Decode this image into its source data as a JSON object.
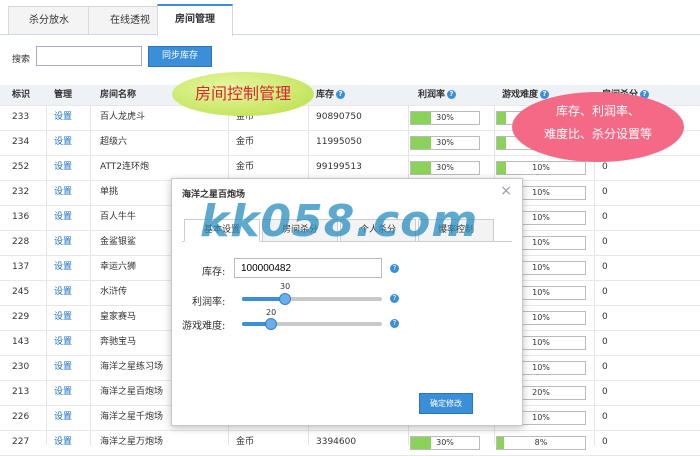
{
  "tabs": [
    "杀分放水",
    "在线透视",
    "房间管理"
  ],
  "active_tab_index": 2,
  "search": {
    "label": "搜索",
    "value": "",
    "button": "同步库存"
  },
  "table": {
    "headers": [
      "标识",
      "管理",
      "房间名称",
      "",
      "库存",
      "利润率",
      "游戏难度",
      "房间杀分"
    ],
    "rows": [
      {
        "id": "233",
        "action": "设置",
        "name": "百人龙虎斗",
        "currency": "金币",
        "stock": "90890750",
        "profit": "30%",
        "profit_pct": 30,
        "difficulty": "10%",
        "diff_pct": 10,
        "kill": "0"
      },
      {
        "id": "234",
        "action": "设置",
        "name": "超级六",
        "currency": "金币",
        "stock": "11995050",
        "profit": "30%",
        "profit_pct": 30,
        "difficulty": "10%",
        "diff_pct": 10,
        "kill": "0"
      },
      {
        "id": "252",
        "action": "设置",
        "name": "ATT2连环炮",
        "currency": "金币",
        "stock": "99199513",
        "profit": "30%",
        "profit_pct": 30,
        "difficulty": "10%",
        "diff_pct": 10,
        "kill": "0"
      },
      {
        "id": "232",
        "action": "设置",
        "name": "单挑",
        "currency": "",
        "stock": "",
        "profit": "",
        "profit_pct": 0,
        "difficulty": "10%",
        "diff_pct": 10,
        "kill": "0"
      },
      {
        "id": "136",
        "action": "设置",
        "name": "百人牛牛",
        "currency": "",
        "stock": "",
        "profit": "",
        "profit_pct": 0,
        "difficulty": "10%",
        "diff_pct": 10,
        "kill": "0"
      },
      {
        "id": "228",
        "action": "设置",
        "name": "金鲨银鲨",
        "currency": "",
        "stock": "",
        "profit": "",
        "profit_pct": 0,
        "difficulty": "10%",
        "diff_pct": 10,
        "kill": "0"
      },
      {
        "id": "137",
        "action": "设置",
        "name": "幸运六狮",
        "currency": "",
        "stock": "",
        "profit": "",
        "profit_pct": 0,
        "difficulty": "10%",
        "diff_pct": 10,
        "kill": "0"
      },
      {
        "id": "245",
        "action": "设置",
        "name": "水浒传",
        "currency": "",
        "stock": "",
        "profit": "",
        "profit_pct": 0,
        "difficulty": "10%",
        "diff_pct": 10,
        "kill": "0"
      },
      {
        "id": "229",
        "action": "设置",
        "name": "皇家赛马",
        "currency": "",
        "stock": "",
        "profit": "",
        "profit_pct": 0,
        "difficulty": "10%",
        "diff_pct": 10,
        "kill": "0"
      },
      {
        "id": "143",
        "action": "设置",
        "name": "奔驰宝马",
        "currency": "",
        "stock": "",
        "profit": "",
        "profit_pct": 0,
        "difficulty": "10%",
        "diff_pct": 10,
        "kill": "0"
      },
      {
        "id": "230",
        "action": "设置",
        "name": "海洋之星练习场",
        "currency": "",
        "stock": "",
        "profit": "",
        "profit_pct": 0,
        "difficulty": "10%",
        "diff_pct": 10,
        "kill": "0"
      },
      {
        "id": "213",
        "action": "设置",
        "name": "海洋之星百炮场",
        "currency": "",
        "stock": "",
        "profit": "",
        "profit_pct": 0,
        "difficulty": "20%",
        "diff_pct": 20,
        "kill": "0"
      },
      {
        "id": "226",
        "action": "设置",
        "name": "海洋之星千炮场",
        "currency": "",
        "stock": "",
        "profit": "",
        "profit_pct": 0,
        "difficulty": "10%",
        "diff_pct": 10,
        "kill": "0"
      },
      {
        "id": "227",
        "action": "设置",
        "name": "海洋之星万炮场",
        "currency": "金币",
        "stock": "3394600",
        "profit": "30%",
        "profit_pct": 30,
        "difficulty": "8%",
        "diff_pct": 8,
        "kill": "0"
      }
    ]
  },
  "callouts": {
    "green": "房间控制管理",
    "red_line1": "库存、利润率、",
    "red_line2": "难度比、杀分设置等"
  },
  "dialog": {
    "title": "海洋之星百炮场",
    "close": "×",
    "tabs": [
      "基本设置",
      "房间杀分",
      "个人杀分",
      "爆率控制"
    ],
    "stock_label": "库存:",
    "stock_value": "100000482",
    "profit_label": "利润率:",
    "profit_value": "30",
    "profit_level": 30,
    "difficulty_label": "游戏难度:",
    "difficulty_value": "20",
    "difficulty_level": 20,
    "confirm": "确定修改"
  },
  "watermark": "kk058.com"
}
